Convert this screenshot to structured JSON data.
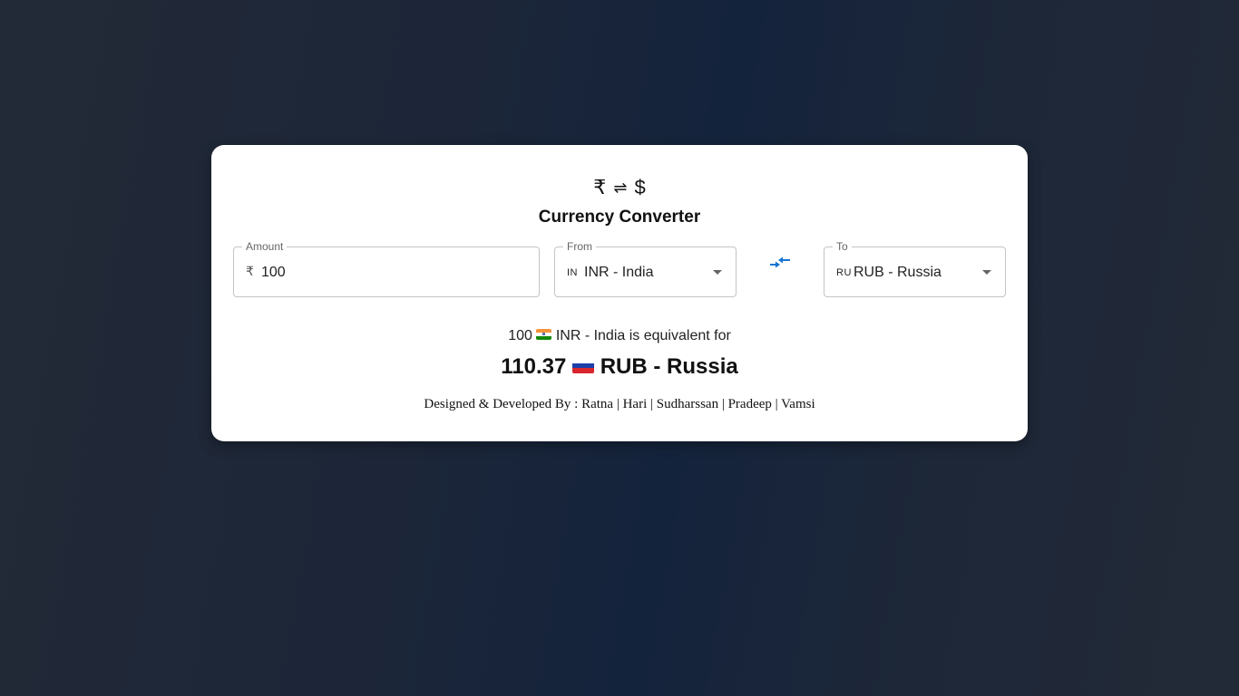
{
  "header": {
    "logo_left": "₹",
    "logo_arrows": "⇌",
    "logo_right": "$",
    "title": "Currency Converter"
  },
  "amount": {
    "label": "Amount",
    "prefix": "₹",
    "value": "100"
  },
  "from": {
    "label": "From",
    "code": "IN",
    "value": "INR - India"
  },
  "to": {
    "label": "To",
    "code": "RU",
    "value": "RUB - Russia"
  },
  "swap_icon": "swap-arrows-icon",
  "result": {
    "amount": "100",
    "from_currency": "INR - India",
    "equivalent_text": "is equivalent for",
    "converted_value": "110.37",
    "to_currency": "RUB - Russia"
  },
  "credits": "Designed & Developed By : Ratna | Hari | Sudharssan | Pradeep | Vamsi",
  "colors": {
    "accent": "#1976d2",
    "background": "#1c2638",
    "card": "#ffffff"
  }
}
